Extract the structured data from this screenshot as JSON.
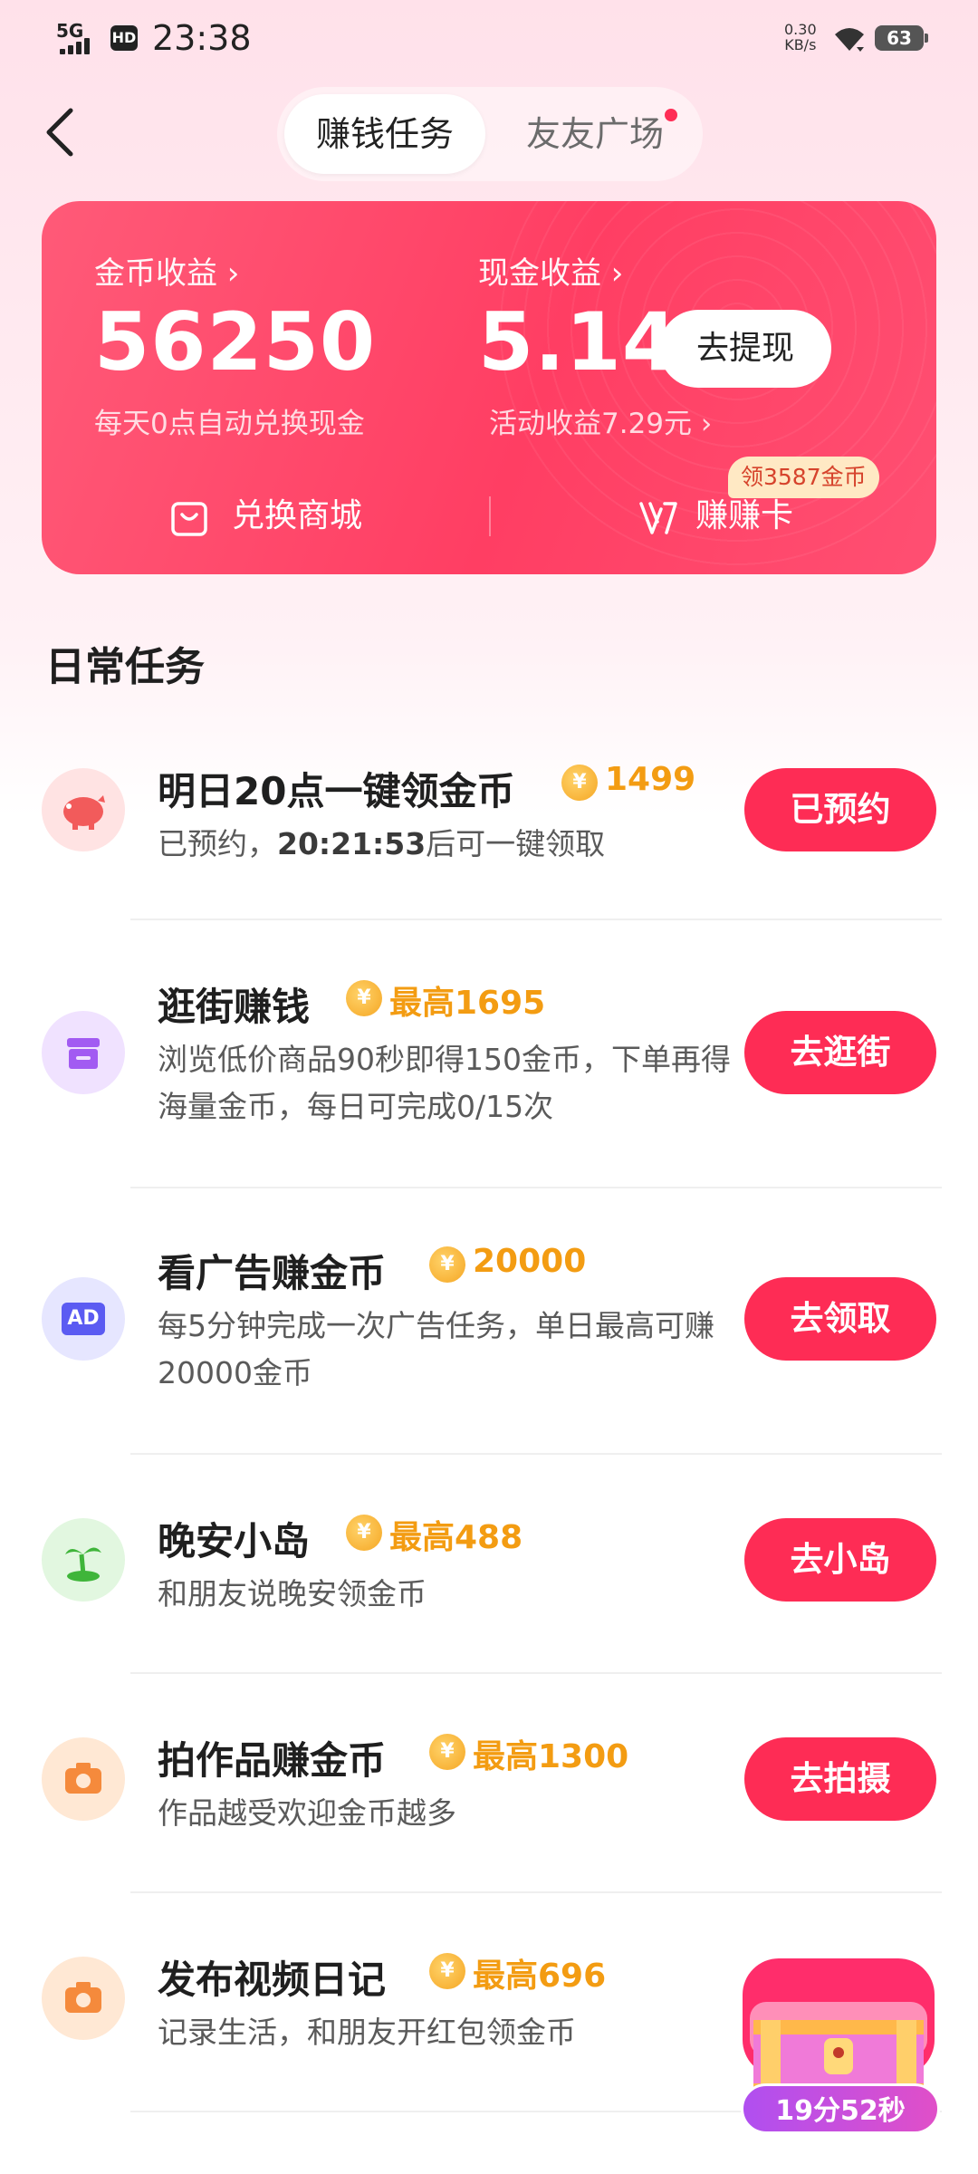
{
  "status_bar": {
    "network": "5G",
    "hd": "HD",
    "time": "23:38",
    "speed_value": "0.30",
    "speed_unit": "KB/s",
    "battery": "63"
  },
  "header": {
    "tabs": [
      {
        "label": "赚钱任务",
        "active": true
      },
      {
        "label": "友友广场",
        "active": false,
        "has_dot": true
      }
    ]
  },
  "earnings": {
    "coin_label": "金币收益 ›",
    "coin_value": "56250",
    "coin_sub": "每天0点自动兑换现金",
    "cash_label": "现金收益 ›",
    "cash_value": "5.14",
    "withdraw_button": "去提现",
    "activity_income": "活动收益7.29元 ›",
    "shop_label": "兑换商城",
    "card_label": "赚赚卡",
    "card_badge": "领3587金币"
  },
  "section_title": "日常任务",
  "tasks": [
    {
      "title": "明日20点一键领金币",
      "reward": "1499",
      "desc_pre": "已预约，",
      "desc_bold": "20:21:53",
      "desc_post": "后可一键领取",
      "button": "已预约",
      "icon": "piggy-bank-icon"
    },
    {
      "title": "逛街赚钱",
      "reward": "最高1695",
      "desc": "浏览低价商品90秒即得150金币，下单再得海量金币，每日可完成0/15次",
      "button": "去逛街",
      "icon": "store-icon"
    },
    {
      "title": "看广告赚金币",
      "reward": "20000",
      "desc": "每5分钟完成一次广告任务，单日最高可赚20000金币",
      "button": "去领取",
      "icon": "ad-icon",
      "icon_text": "AD"
    },
    {
      "title": "晚安小岛",
      "reward": "最高488",
      "desc": "和朋友说晚安领金币",
      "button": "去小岛",
      "icon": "island-icon"
    },
    {
      "title": "拍作品赚金币",
      "reward": "最高1300",
      "desc": "作品越受欢迎金币越多",
      "button": "去拍摄",
      "icon": "camera-icon"
    },
    {
      "title": "发布视频日记",
      "reward": "最高696",
      "desc": "记录生活，和朋友开红包领金币",
      "button": "",
      "icon": "camera-icon"
    }
  ],
  "coin_symbol": "¥",
  "treasure_timer": "19分52秒",
  "colors": {
    "accent": "#fe2c55",
    "reward": "#f39c12",
    "card": "#ff4a6c"
  }
}
